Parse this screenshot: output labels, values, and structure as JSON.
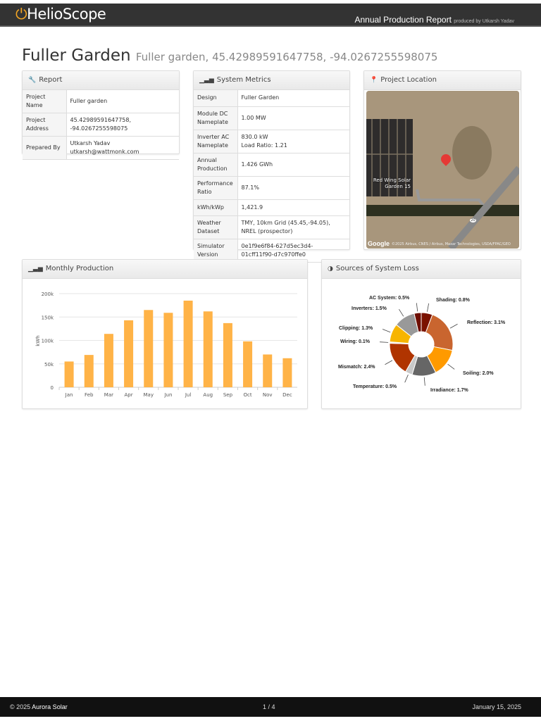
{
  "header": {
    "logo": "HelioScope",
    "report_title": "Annual Production Report",
    "produced_by": "produced by Utkarsh Yadav"
  },
  "page": {
    "title": "Fuller Garden",
    "subtitle": "Fuller garden, 45.42989591647758, -94.0267255598075"
  },
  "report": {
    "title": "Report",
    "rows": [
      {
        "k": "Project Name",
        "v": "Fuller garden",
        "v2": ""
      },
      {
        "k": "Project Address",
        "v": "45.42989591647758,",
        "v2": "-94.0267255598075"
      },
      {
        "k": "Prepared By",
        "v": "Utkarsh Yadav",
        "v2": "utkarsh@wattmonk.com"
      }
    ]
  },
  "metrics": {
    "title": "System Metrics",
    "rows": [
      {
        "k": "Design",
        "v": "Fuller Garden",
        "v2": ""
      },
      {
        "k": "Module DC Nameplate",
        "v": "1.00 MW",
        "v2": ""
      },
      {
        "k": "Inverter AC Nameplate",
        "v": "830.0 kW",
        "v2": "Load Ratio: 1.21"
      },
      {
        "k": "Annual Production",
        "v": "1.426 GWh",
        "v2": ""
      },
      {
        "k": "Performance Ratio",
        "v": "87.1%",
        "v2": ""
      },
      {
        "k": "kWh/kWp",
        "v": "1,421.9",
        "v2": ""
      },
      {
        "k": "Weather Dataset",
        "v": "TMY, 10km Grid (45.45,-94.05),",
        "v2": "NREL (prospector)"
      },
      {
        "k": "Simulator Version",
        "v": "0e1f9e6f84-627d5ec3d4-",
        "v2": "01cff11f90-d7c970ffe0"
      }
    ]
  },
  "location": {
    "title": "Project Location",
    "place_label": "Red Wing Solar Garden 15",
    "road": "20",
    "attribution": "©2025 Airbus, CNES / Airbus, Maxar Technologies, USDA/FPAC/GEO",
    "google": "Google"
  },
  "monthly": {
    "title": "Monthly Production"
  },
  "loss": {
    "title": "Sources of System Loss"
  },
  "chart_data": [
    {
      "type": "bar",
      "title": "Monthly Production",
      "ylabel": "kWh",
      "categories": [
        "Jan",
        "Feb",
        "Mar",
        "Apr",
        "May",
        "Jun",
        "Jul",
        "Aug",
        "Sep",
        "Oct",
        "Nov",
        "Dec"
      ],
      "values": [
        55000,
        69000,
        114000,
        143000,
        165000,
        159000,
        185000,
        162000,
        137000,
        98000,
        70000,
        62000
      ],
      "ylim": [
        0,
        200000
      ],
      "yticks": [
        "0",
        "50k",
        "100k",
        "150k",
        "200k"
      ],
      "color": "#ffb347",
      "grid": true
    },
    {
      "type": "pie",
      "title": "Sources of System Loss",
      "slices": [
        {
          "name": "Shading",
          "value": 0.8,
          "label": "Shading: 0.8%",
          "color": "#7a1200"
        },
        {
          "name": "Reflection",
          "value": 3.1,
          "label": "Reflection: 3.1%",
          "color": "#c9652f"
        },
        {
          "name": "Soiling",
          "value": 2.0,
          "label": "Soiling: 2.0%",
          "color": "#ff9a00"
        },
        {
          "name": "Irradiance",
          "value": 1.7,
          "label": "Irradiance: 1.7%",
          "color": "#666666"
        },
        {
          "name": "Temperature",
          "value": 0.5,
          "label": "Temperature: 0.5%",
          "color": "#c8c8c8"
        },
        {
          "name": "Mismatch",
          "value": 2.4,
          "label": "Mismatch: 2.4%",
          "color": "#b03400"
        },
        {
          "name": "Wiring",
          "value": 0.1,
          "label": "Wiring: 0.1%",
          "color": "#eeeeee"
        },
        {
          "name": "Clipping",
          "value": 1.3,
          "label": "Clipping: 1.3%",
          "color": "#f7b500"
        },
        {
          "name": "Inverters",
          "value": 1.5,
          "label": "Inverters: 1.5%",
          "color": "#999999"
        },
        {
          "name": "AC System",
          "value": 0.5,
          "label": "AC System: 0.5%",
          "color": "#6e0e00"
        }
      ]
    }
  ],
  "footer": {
    "copyright": "© 2025",
    "brand": "Aurora Solar",
    "page": "1 / 4",
    "date": "January 15, 2025"
  }
}
